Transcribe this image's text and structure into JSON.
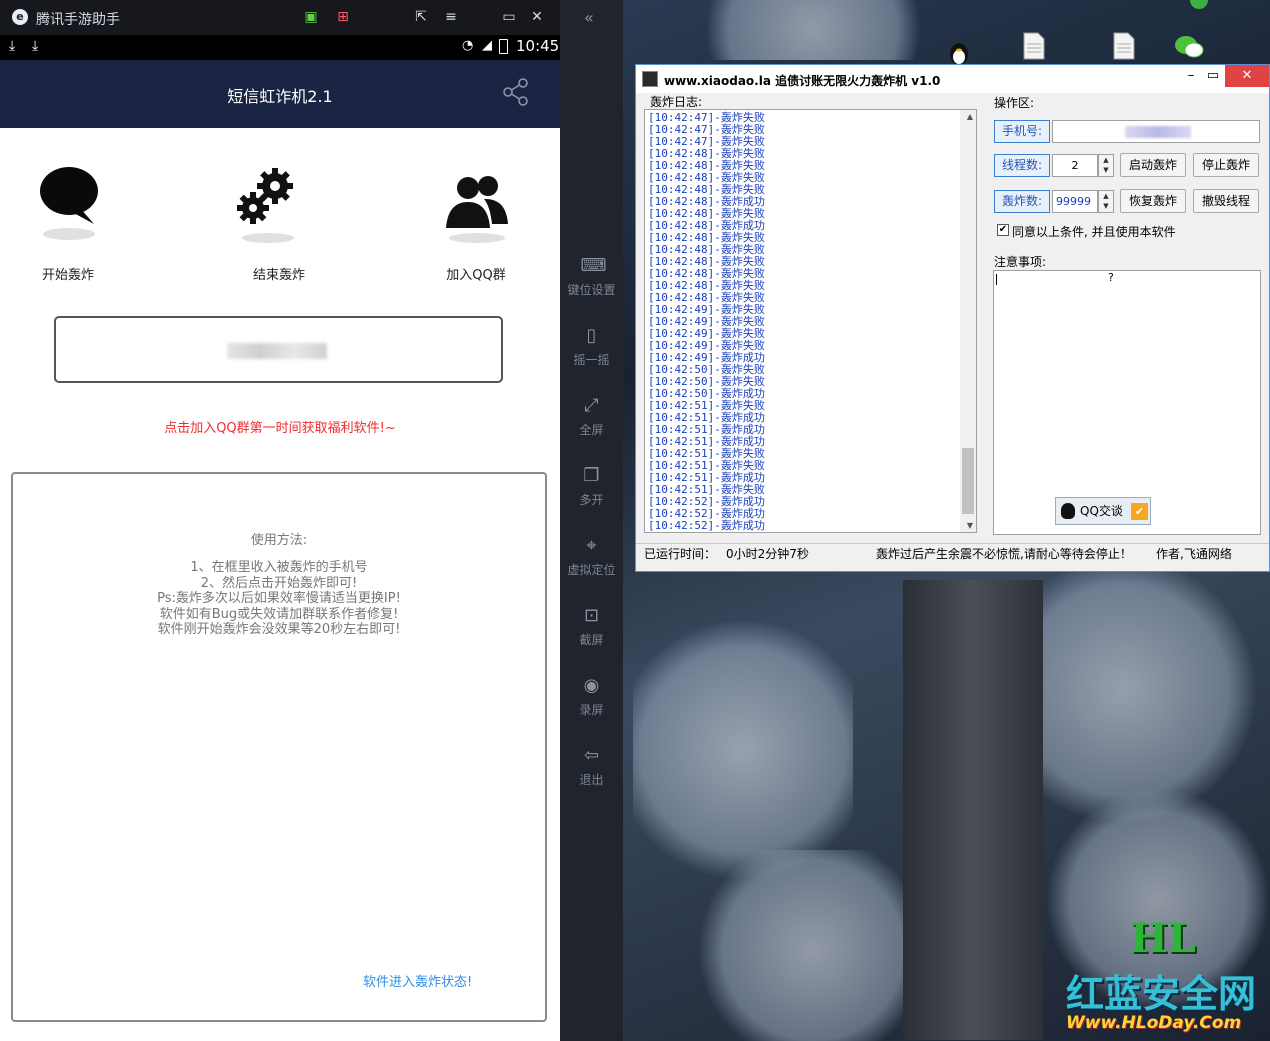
{
  "emulator": {
    "title": "腾讯手游助手",
    "status_time": "10:45",
    "app_title": "短信虹诈机2.1",
    "actions": [
      {
        "label": "开始轰炸",
        "icon": "chat-bubble-icon"
      },
      {
        "label": "结束轰炸",
        "icon": "gears-icon"
      },
      {
        "label": "加入QQ群",
        "icon": "users-icon"
      }
    ],
    "promo": "点击加入QQ群第一时间获取福利软件!~",
    "usage_heading": "使用方法:",
    "usage_lines": [
      "1、在框里收入被轰炸的手机号",
      "2、然后点击开始轰炸即可!",
      "Ps:轰炸多次以后如果效率慢请适当更换IP!",
      "软件如有Bug或失效请加群联系作者修复!",
      "软件刚开始轰炸会没效果等20秒左右即可!"
    ],
    "enter_state": "软件进入轰炸状态!"
  },
  "sidebar": [
    {
      "label": "键位设置",
      "icon": "keyboard-icon"
    },
    {
      "label": "摇一摇",
      "icon": "shake-icon"
    },
    {
      "label": "全屏",
      "icon": "fullscreen-icon"
    },
    {
      "label": "多开",
      "icon": "multi-window-icon"
    },
    {
      "label": "虚拟定位",
      "icon": "location-icon"
    },
    {
      "label": "截屏",
      "icon": "screenshot-icon"
    },
    {
      "label": "录屏",
      "icon": "record-icon"
    },
    {
      "label": "退出",
      "icon": "exit-icon"
    }
  ],
  "app": {
    "title": "www.xiaodao.la 追债讨账无限火力轰炸机 v1.0",
    "log_label": "轰炸日志:",
    "ops_label": "操作区:",
    "phone_label": "手机号:",
    "threads_label": "线程数:",
    "threads_value": "2",
    "count_label": "轰炸数:",
    "count_value": "99999",
    "start_btn": "启动轰炸",
    "stop_btn": "停止轰炸",
    "resume_btn": "恢复轰炸",
    "destroy_btn": "撤毁线程",
    "agree_label": "同意以上条件, 并且使用本软件",
    "notes_label": "注意事项:",
    "notes_mark": "?",
    "qq_btn": "QQ交谈",
    "log": [
      "[10:42:47]-轰炸失败",
      "[10:42:47]-轰炸失败",
      "[10:42:47]-轰炸失败",
      "[10:42:48]-轰炸失败",
      "[10:42:48]-轰炸失败",
      "[10:42:48]-轰炸失败",
      "[10:42:48]-轰炸失败",
      "[10:42:48]-轰炸成功",
      "[10:42:48]-轰炸失败",
      "[10:42:48]-轰炸成功",
      "[10:42:48]-轰炸失败",
      "[10:42:48]-轰炸失败",
      "[10:42:48]-轰炸失败",
      "[10:42:48]-轰炸失败",
      "[10:42:48]-轰炸失败",
      "[10:42:48]-轰炸失败",
      "[10:42:49]-轰炸失败",
      "[10:42:49]-轰炸失败",
      "[10:42:49]-轰炸失败",
      "[10:42:49]-轰炸失败",
      "[10:42:49]-轰炸成功",
      "[10:42:50]-轰炸失败",
      "[10:42:50]-轰炸失败",
      "[10:42:50]-轰炸成功",
      "[10:42:51]-轰炸失败",
      "[10:42:51]-轰炸成功",
      "[10:42:51]-轰炸成功",
      "[10:42:51]-轰炸成功",
      "[10:42:51]-轰炸失败",
      "[10:42:51]-轰炸失败",
      "[10:42:51]-轰炸成功",
      "[10:42:51]-轰炸失败",
      "[10:42:52]-轰炸成功",
      "[10:42:52]-轰炸成功",
      "[10:42:52]-轰炸成功"
    ],
    "status_runtime_label": "已运行时间：",
    "status_runtime": "0小时2分钟7秒",
    "status_msg": "轰炸过后产生余震不必惊慌,请耐心等待会停止！",
    "status_author": "作者,飞通网络"
  },
  "watermark": {
    "logo": "HL",
    "name": "红蓝安全网",
    "url": "Www.HLoDay.Com"
  },
  "colors": {
    "header": "#1b2443",
    "promo": "#f22b2b",
    "link": "#2f8ee8",
    "log_text": "#1a3fb8",
    "close": "#e04343"
  }
}
